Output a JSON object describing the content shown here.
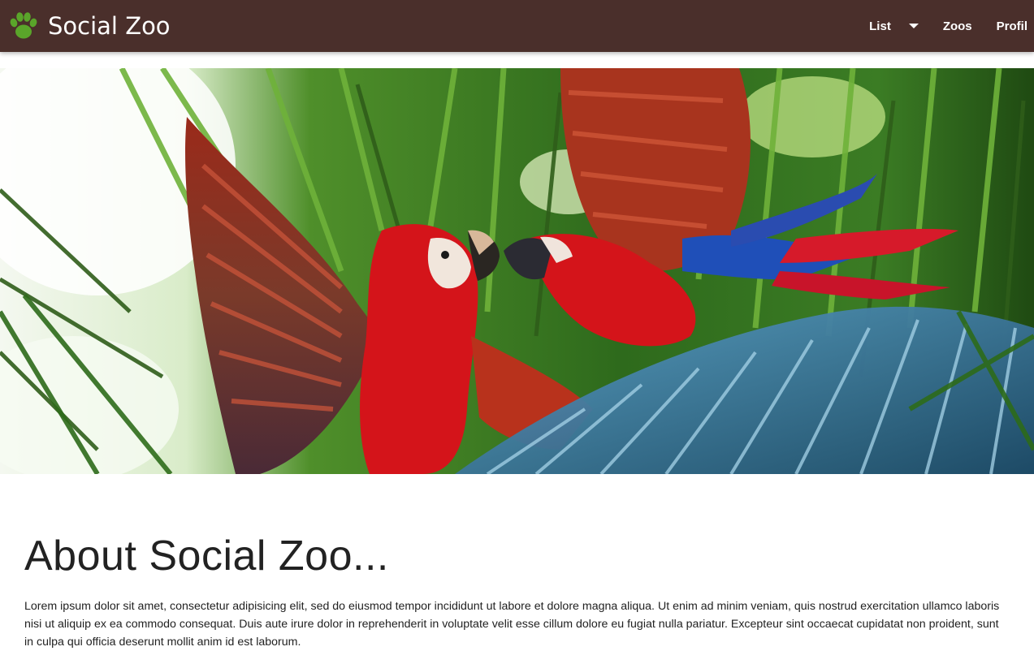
{
  "colors": {
    "navbar_bg": "#4a2f2b",
    "brand_icon": "#5aa52a",
    "nav_text": "#ffffff",
    "heading_text": "#222222"
  },
  "header": {
    "brand_name": "Social Zoo",
    "brand_icon": "paw-icon",
    "nav": {
      "list_label": "List",
      "list_icon": "caret-down-icon",
      "zoos_label": "Zoos",
      "profil_label": "Profil"
    }
  },
  "hero": {
    "image": "scarlet-macaws-in-palm-leaves"
  },
  "about": {
    "title": "About Social Zoo...",
    "body": "Lorem ipsum dolor sit amet, consectetur adipisicing elit, sed do eiusmod tempor incididunt ut labore et dolore magna aliqua. Ut enim ad minim veniam, quis nostrud exercitation ullamco laboris nisi ut aliquip ex ea commodo consequat. Duis aute irure dolor in reprehenderit in voluptate velit esse cillum dolore eu fugiat nulla pariatur. Excepteur sint occaecat cupidatat non proident, sunt in culpa qui officia deserunt mollit anim id est laborum."
  }
}
